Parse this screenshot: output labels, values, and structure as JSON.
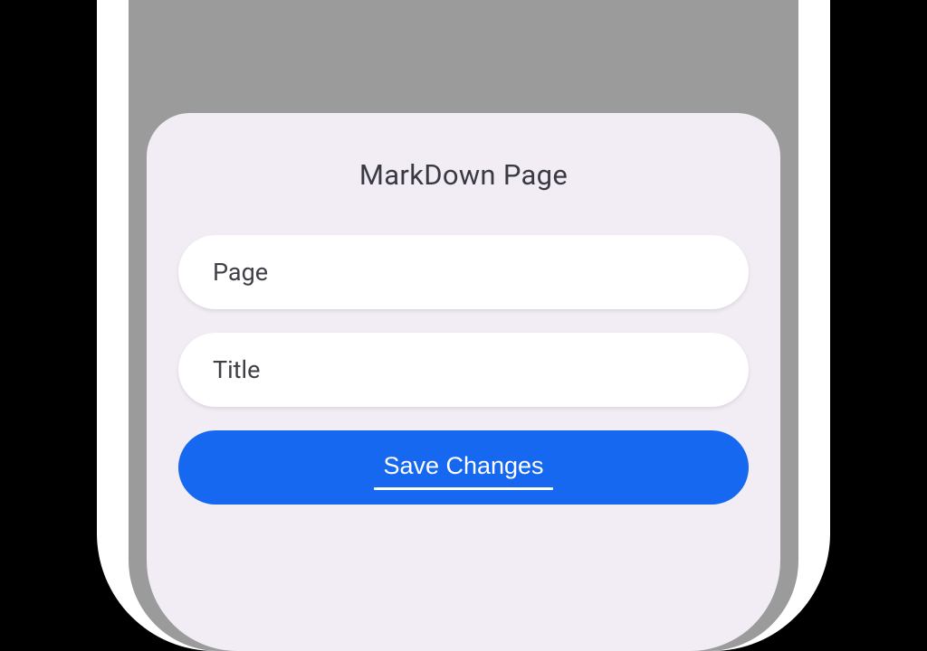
{
  "modal": {
    "title": "MarkDown Page",
    "fields": {
      "page": {
        "placeholder": "Page",
        "value": ""
      },
      "title": {
        "placeholder": "Title",
        "value": ""
      }
    },
    "save_label": "Save Changes"
  }
}
